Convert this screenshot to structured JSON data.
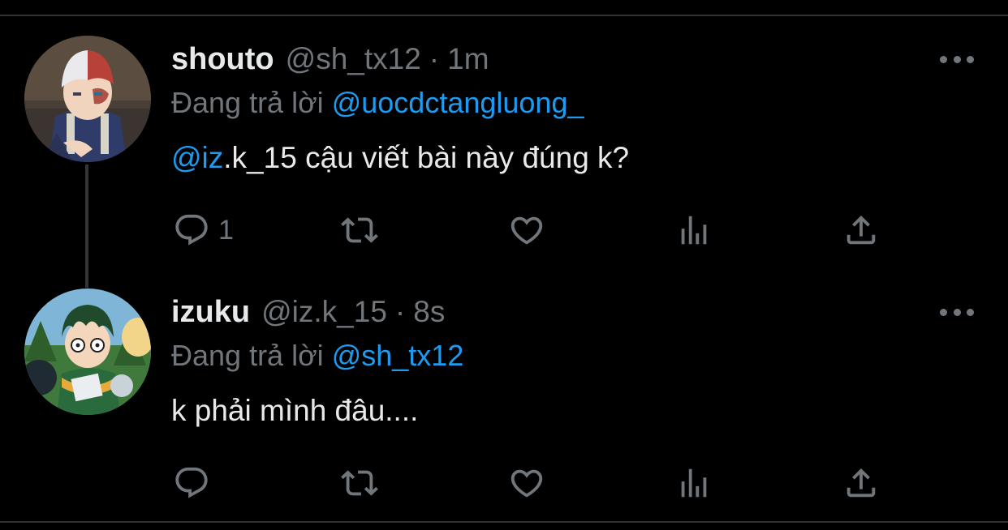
{
  "tweets": [
    {
      "name": "shouto",
      "handle": "@sh_tx12",
      "separator": "·",
      "time": "1m",
      "reply_prefix": "Đang trả lời",
      "reply_to": "@uocdctangluong_",
      "body_mention": "@iz",
      "body_text": ".k_15 cậu viết bài này đúng k?",
      "reply_count": "1"
    },
    {
      "name": "izuku",
      "handle": "@iz.k_15",
      "separator": "·",
      "time": "8s",
      "reply_prefix": "Đang trả lời",
      "reply_to": "@sh_tx12",
      "body_mention": "",
      "body_text": "k phải mình đâu....",
      "reply_count": ""
    }
  ],
  "colors": {
    "background": "#000000",
    "text": "#e7e9ea",
    "muted": "#71767b",
    "accent": "#1d9bf0",
    "divider": "#2f3336"
  },
  "icons": [
    "reply-icon",
    "retweet-icon",
    "like-icon",
    "views-icon",
    "share-icon",
    "more-icon"
  ]
}
